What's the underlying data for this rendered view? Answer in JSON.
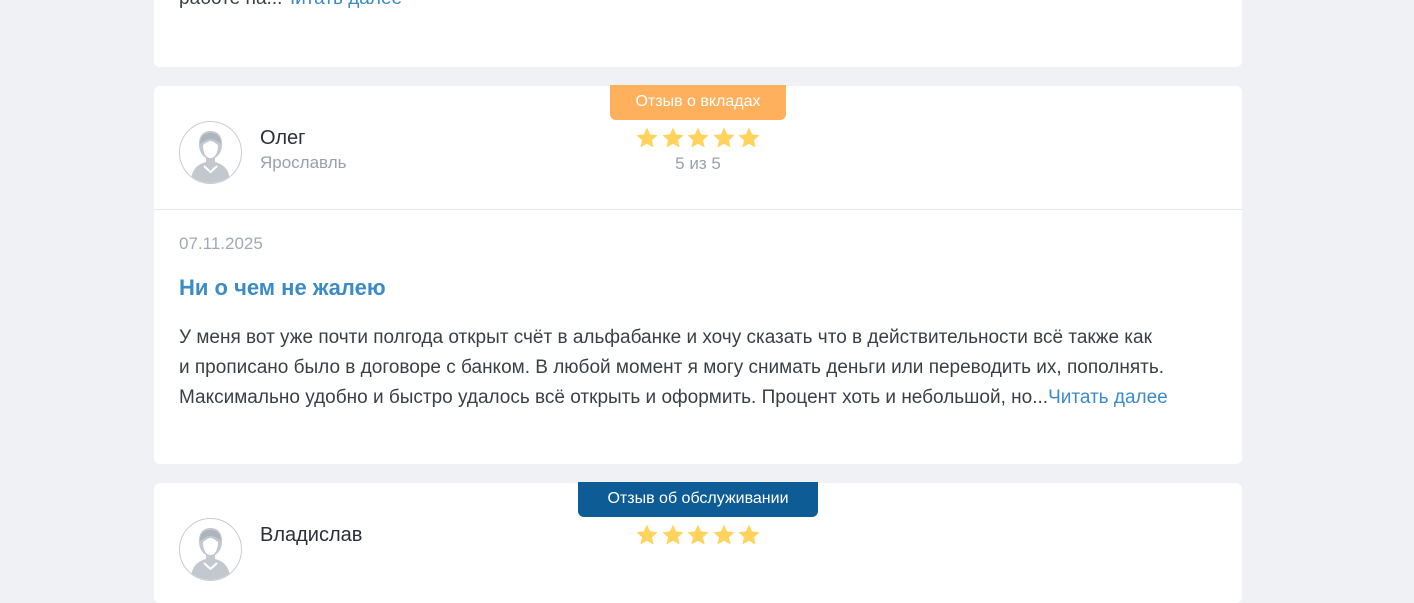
{
  "reviews_top": {
    "snippet_text": "работе на...",
    "read_more_label": "Читать далее"
  },
  "review_main": {
    "tag_label": "Отзыв о вкладах",
    "tag_color": "#ffb05c",
    "author_name": "Олег",
    "author_city": "Ярославль",
    "rating_stars": 5,
    "rating_text": "5 из 5",
    "date": "07.11.2025",
    "title": "Ни о чем не жалею",
    "body_lines": [
      "У меня вот уже почти полгода открыт счёт в альфабанке и хочу сказать что в действительности всё также как",
      "и прописано было в договоре с банком. В любой момент я могу снимать деньги или переводить их, пополнять.",
      "Максимально удобно и быстро удалось всё открыть и оформить. Процент хоть и небольшой, но..."
    ],
    "read_more_label": "Читать далее"
  },
  "review_next": {
    "tag_label": "Отзыв об обслуживании",
    "tag_color": "#0d5c96",
    "author_name": "Владислав",
    "rating_stars": 5
  },
  "colors": {
    "background": "#eff1f4",
    "card": "#ffffff",
    "link": "#3b8cc4",
    "star": "#ffd35c",
    "muted_text": "#9aa1ab"
  },
  "icons": {
    "avatar": "user-avatar-icon",
    "star": "star-icon"
  }
}
